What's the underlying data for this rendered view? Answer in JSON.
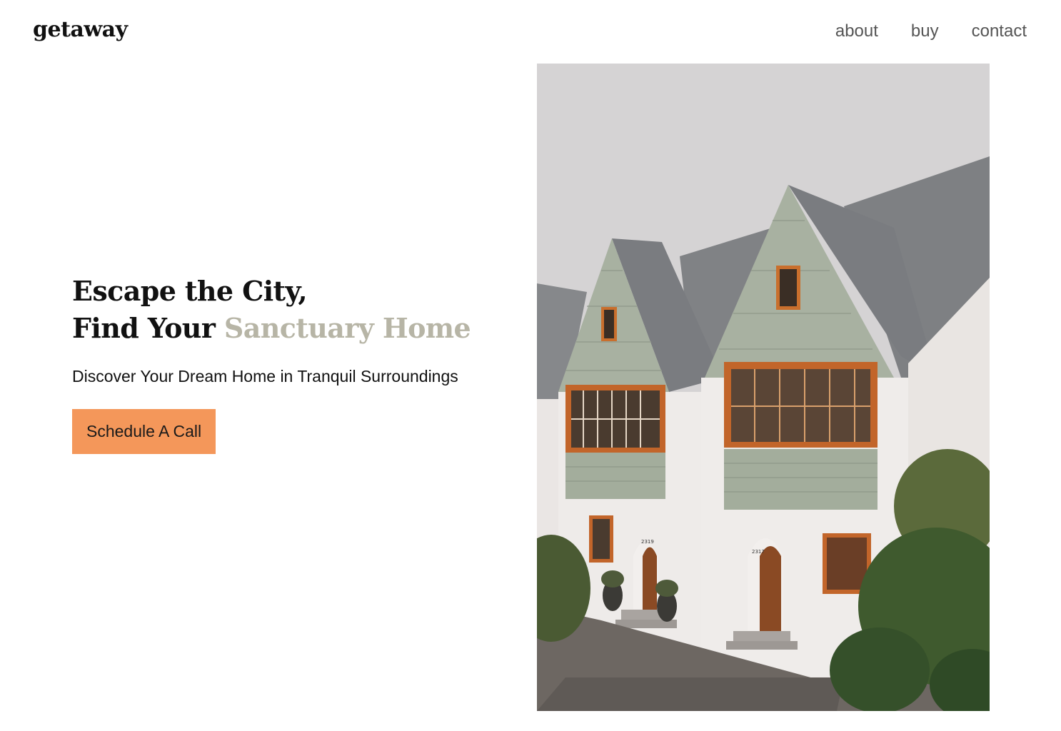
{
  "header": {
    "logo": "getaway",
    "nav": [
      {
        "label": "about"
      },
      {
        "label": "buy"
      },
      {
        "label": "contact"
      }
    ]
  },
  "hero": {
    "headline_line1": "Escape the City,",
    "headline_line2_prefix": "Find Your ",
    "headline_line2_accent": "Sanctuary Home",
    "subheading": "Discover Your Dream Home in Tranquil Surroundings",
    "cta_label": "Schedule A Call"
  },
  "image": {
    "house_number_left": "2319",
    "house_number_right": "2317"
  },
  "colors": {
    "accent_text": "#b7b5a6",
    "cta_background": "#f4975a",
    "nav_text": "#555555"
  }
}
